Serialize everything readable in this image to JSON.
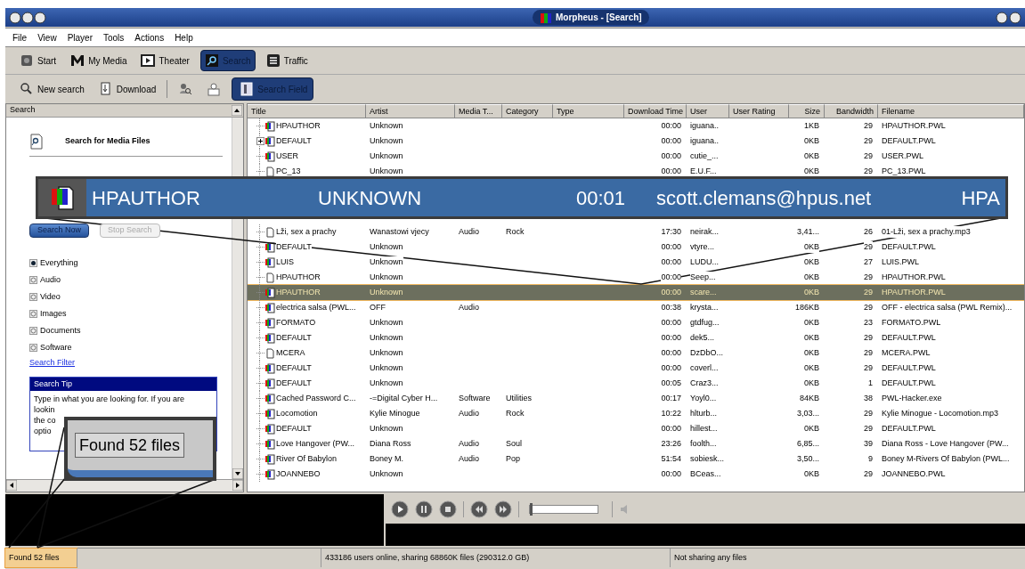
{
  "window": {
    "title": "Morpheus - [Search]"
  },
  "menu": [
    "File",
    "View",
    "Player",
    "Tools",
    "Actions",
    "Help"
  ],
  "toolbar": [
    {
      "kind": "start",
      "label": "Start",
      "selected": false
    },
    {
      "kind": "media",
      "label": "My Media",
      "selected": false
    },
    {
      "kind": "theater",
      "label": "Theater",
      "selected": false
    },
    {
      "kind": "search",
      "label": "Search",
      "selected": true
    },
    {
      "kind": "traffic",
      "label": "Traffic",
      "selected": false
    }
  ],
  "search_toolbar": [
    {
      "kind": "new",
      "label": "New search",
      "selected": false
    },
    {
      "kind": "download",
      "label": "Download",
      "selected": false
    },
    {
      "kind": "find-user",
      "selected": false
    },
    {
      "kind": "user",
      "selected": false
    },
    {
      "kind": "fields",
      "label": "Search Field",
      "selected": true
    }
  ],
  "search_panel": {
    "header": "Search",
    "title": "Search for Media Files",
    "buttons": [
      {
        "label": "Search Now",
        "disabled": false
      },
      {
        "label": "Stop Search",
        "disabled": true
      }
    ],
    "media_types": [
      {
        "label": "Everything",
        "selected": true
      },
      {
        "label": "Audio",
        "selected": false
      },
      {
        "label": "Video",
        "selected": false
      },
      {
        "label": "Images",
        "selected": false
      },
      {
        "label": "Documents",
        "selected": false
      },
      {
        "label": "Software",
        "selected": false
      }
    ],
    "filter_link": "Search Filter",
    "tip": {
      "title": "Search Tip",
      "lines": [
        "Type in what you are looking for. If you are",
        "lookin",
        "the co",
        "optio"
      ]
    }
  },
  "results": {
    "columns": [
      "Title",
      "Artist",
      "Media T...",
      "Category",
      "Type",
      "Download Time",
      "User",
      "User Rating",
      "Size",
      "Bandwidth",
      "Filename"
    ],
    "rows": [
      {
        "kind": "media",
        "has_children": false,
        "selected": false,
        "title": "HPAUTHOR",
        "artist": "Unknown",
        "download_time": "00:00",
        "user": "iguana..",
        "size": "1KB",
        "bandwidth": "29",
        "filename": "HPAUTHOR.PWL"
      },
      {
        "kind": "media",
        "has_children": true,
        "selected": false,
        "title": "DEFAULT",
        "artist": "Unknown",
        "download_time": "00:00",
        "user": "iguana..",
        "size": "0KB",
        "bandwidth": "29",
        "filename": "DEFAULT.PWL"
      },
      {
        "kind": "media",
        "has_children": false,
        "selected": false,
        "title": "USER",
        "artist": "Unknown",
        "download_time": "00:00",
        "user": "cutie_...",
        "size": "0KB",
        "bandwidth": "29",
        "filename": "USER.PWL"
      },
      {
        "kind": "file",
        "has_children": false,
        "selected": false,
        "title": "PC_13",
        "artist": "Unknown",
        "download_time": "00:00",
        "user": "E.U.F...",
        "size": "0KB",
        "bandwidth": "29",
        "filename": "PC_13.PWL"
      },
      {
        "kind": "file",
        "has_children": false,
        "selected": false,
        "title": "Lži, sex a prachy",
        "artist": "Wanastowi vjecy",
        "media_type": "Audio",
        "category": "Rock",
        "download_time": "17:30",
        "user": "neirak...",
        "size": "3,41...",
        "bandwidth": "26",
        "filename": "01-Lži, sex a prachy.mp3"
      },
      {
        "kind": "media",
        "has_children": false,
        "selected": false,
        "title": "DEFAULT",
        "artist": "Unknown",
        "download_time": "00:00",
        "user": "vtyre...",
        "size": "0KB",
        "bandwidth": "29",
        "filename": "DEFAULT.PWL"
      },
      {
        "kind": "media",
        "has_children": false,
        "selected": false,
        "title": "LUIS",
        "artist": "Unknown",
        "download_time": "00:00",
        "user": "LUDU...",
        "size": "0KB",
        "bandwidth": "27",
        "filename": "LUIS.PWL"
      },
      {
        "kind": "file",
        "has_children": false,
        "selected": false,
        "title": "HPAUTHOR",
        "artist": "Unknown",
        "download_time": "00:00",
        "user": "Seep...",
        "size": "0KB",
        "bandwidth": "29",
        "filename": "HPAUTHOR.PWL"
      },
      {
        "kind": "media",
        "has_children": false,
        "selected": true,
        "title": "HPAUTHOR",
        "artist": "Unknown",
        "download_time": "00:00",
        "user": "scare...",
        "size": "0KB",
        "bandwidth": "29",
        "filename": "HPAUTHOR.PWL"
      },
      {
        "kind": "media",
        "has_children": false,
        "selected": false,
        "title": "electrica salsa (PWL...",
        "artist": "OFF",
        "media_type": "Audio",
        "download_time": "00:38",
        "user": "krysta...",
        "size": "186KB",
        "bandwidth": "29",
        "filename": "OFF - electrica salsa (PWL Remix)..."
      },
      {
        "kind": "media",
        "has_children": false,
        "selected": false,
        "title": "FORMATO",
        "artist": "Unknown",
        "download_time": "00:00",
        "user": "gtdfug...",
        "size": "0KB",
        "bandwidth": "23",
        "filename": "FORMATO.PWL"
      },
      {
        "kind": "media",
        "has_children": false,
        "selected": false,
        "title": "DEFAULT",
        "artist": "Unknown",
        "download_time": "00:00",
        "user": "dek5...",
        "size": "0KB",
        "bandwidth": "29",
        "filename": "DEFAULT.PWL"
      },
      {
        "kind": "file",
        "has_children": false,
        "selected": false,
        "title": "MCERA",
        "artist": "Unknown",
        "download_time": "00:00",
        "user": "DzDbO...",
        "size": "0KB",
        "bandwidth": "29",
        "filename": "MCERA.PWL"
      },
      {
        "kind": "media",
        "has_children": false,
        "selected": false,
        "title": "DEFAULT",
        "artist": "Unknown",
        "download_time": "00:00",
        "user": "coverl...",
        "size": "0KB",
        "bandwidth": "29",
        "filename": "DEFAULT.PWL"
      },
      {
        "kind": "media",
        "has_children": false,
        "selected": false,
        "title": "DEFAULT",
        "artist": "Unknown",
        "download_time": "00:05",
        "user": "Craz3...",
        "size": "0KB",
        "bandwidth": "1",
        "filename": "DEFAULT.PWL"
      },
      {
        "kind": "media",
        "has_children": false,
        "selected": false,
        "title": "Cached Password C...",
        "artist": "-=Digital Cyber H...",
        "media_type": "Software",
        "category": "Utilities",
        "download_time": "00:17",
        "user": "Yoyl0...",
        "size": "84KB",
        "bandwidth": "38",
        "filename": "PWL-Hacker.exe"
      },
      {
        "kind": "media",
        "has_children": false,
        "selected": false,
        "title": "Locomotion",
        "artist": "Kylie Minogue",
        "media_type": "Audio",
        "category": "Rock",
        "download_time": "10:22",
        "user": "hlturb...",
        "size": "3,03...",
        "bandwidth": "29",
        "filename": "Kylie Minogue - Locomotion.mp3"
      },
      {
        "kind": "media",
        "has_children": false,
        "selected": false,
        "title": "DEFAULT",
        "artist": "Unknown",
        "download_time": "00:00",
        "user": "hillest...",
        "size": "0KB",
        "bandwidth": "29",
        "filename": "DEFAULT.PWL"
      },
      {
        "kind": "media",
        "has_children": false,
        "selected": false,
        "title": "Love Hangover (PW...",
        "artist": "Diana Ross",
        "media_type": "Audio",
        "category": "Soul",
        "download_time": "23:26",
        "user": "foolth...",
        "size": "6,85...",
        "bandwidth": "39",
        "filename": "Diana Ross - Love Hangover (PW..."
      },
      {
        "kind": "media",
        "has_children": false,
        "selected": false,
        "title": "River Of Babylon",
        "artist": "Boney M.",
        "media_type": "Audio",
        "category": "Pop",
        "download_time": "51:54",
        "user": "sobiesk...",
        "size": "3,50...",
        "bandwidth": "9",
        "filename": "Boney M-Rivers Of Babylon (PWL..."
      },
      {
        "kind": "media",
        "has_children": false,
        "selected": false,
        "title": "JOANNEBO",
        "artist": "Unknown",
        "download_time": "00:00",
        "user": "BCeas...",
        "size": "0KB",
        "bandwidth": "29",
        "filename": "JOANNEBO.PWL"
      }
    ]
  },
  "player": {
    "volume": {
      "level": 0.0
    }
  },
  "status_bar": {
    "found": {
      "text": "Found 52 files",
      "highlighted": true
    },
    "users": "433186 users online, sharing 68860K files (290312.0 GB)",
    "sharing": "Not sharing any files"
  },
  "callouts": [
    {
      "kind": "row",
      "cells": [
        "HPAUTHOR",
        "UNKNOWN",
        "00:01",
        "scott.clemans@hpus.net",
        "HPA"
      ]
    },
    {
      "kind": "status",
      "text": "Found 52 files"
    }
  ]
}
